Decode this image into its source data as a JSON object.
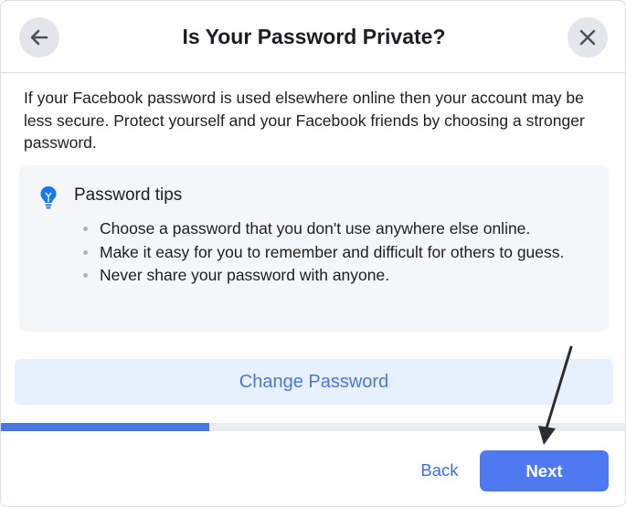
{
  "dialog": {
    "title": "Is Your Password Private?",
    "back_icon": "arrow-left-icon",
    "close_icon": "close-icon"
  },
  "intro_text": "If your Facebook password is used elsewhere online then your account may be less secure. Protect yourself and your Facebook friends by choosing a stronger password.",
  "tips": {
    "icon": "lightbulb-icon",
    "heading": "Password tips",
    "items": [
      "Choose a password that you don't use anywhere else online.",
      "Make it easy for you to remember and difficult for others to guess.",
      "Never share your password with anyone."
    ]
  },
  "change_password_label": "Change Password",
  "progress": {
    "fraction": 0.333
  },
  "footer": {
    "back_label": "Back",
    "next_label": "Next"
  },
  "colors": {
    "accent": "#4f7aef",
    "accent_light": "#e7f0fd",
    "tips_bg": "#f5f6f7",
    "icon_blue": "#1877f2",
    "annotation_arrow": "#2b2d33"
  }
}
